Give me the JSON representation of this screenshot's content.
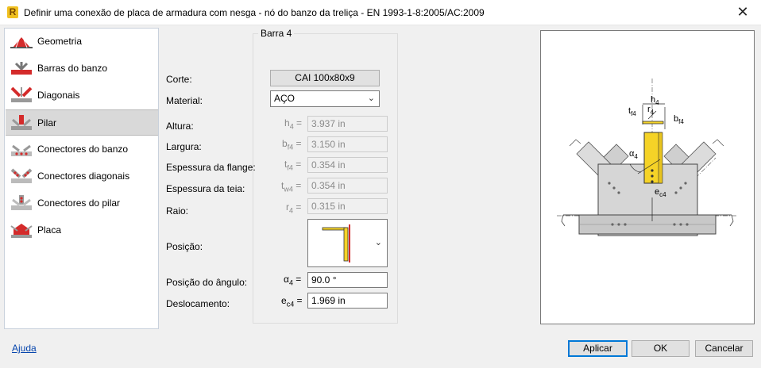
{
  "window": {
    "title": "Definir uma conexão de placa de armadura com nesga - nó do banzo da treliça - EN 1993-1-8:2005/AC:2009",
    "close": "✕"
  },
  "nav": {
    "items": [
      {
        "label": "Geometria",
        "icon": "truss-geometry-icon"
      },
      {
        "label": "Barras do banzo",
        "icon": "chord-bars-icon"
      },
      {
        "label": "Diagonais",
        "icon": "diagonals-icon"
      },
      {
        "label": "Pilar",
        "icon": "column-icon",
        "selected": true
      },
      {
        "label": "Conectores do banzo",
        "icon": "chord-connectors-icon"
      },
      {
        "label": "Conectores diagonais",
        "icon": "diagonal-connectors-icon"
      },
      {
        "label": "Conectores do pilar",
        "icon": "column-connectors-icon"
      },
      {
        "label": "Placa",
        "icon": "plate-icon"
      }
    ]
  },
  "form": {
    "group_title": "Barra 4",
    "corte": {
      "label": "Corte:",
      "value": "CAI 100x80x9"
    },
    "material": {
      "label": "Material:",
      "value": "AÇO"
    },
    "altura": {
      "label": "Altura:",
      "sym": "h",
      "sub": "4",
      "eq": "=",
      "value": "3.937 in"
    },
    "largura": {
      "label": "Largura:",
      "sym": "b",
      "sub": "f4",
      "eq": "=",
      "value": "3.150 in"
    },
    "esp_flange": {
      "label": "Espessura da flange:",
      "sym": "t",
      "sub": "f4",
      "eq": "=",
      "value": "0.354 in"
    },
    "esp_teia": {
      "label": "Espessura da teia:",
      "sym": "t",
      "sub": "w4",
      "eq": "=",
      "value": "0.354 in"
    },
    "raio": {
      "label": "Raio:",
      "sym": "r",
      "sub": "4",
      "eq": "=",
      "value": "0.315 in"
    },
    "posicao": {
      "label": "Posição:"
    },
    "pos_angulo": {
      "label": "Posição do ângulo:",
      "sym": "α",
      "sub": "4",
      "eq": "=",
      "value": "90.0 °"
    },
    "deslocamento": {
      "label": "Deslocamento:",
      "sym": "e",
      "sub": "c4",
      "eq": "=",
      "value": "1.969 in"
    }
  },
  "preview": {
    "labels": {
      "h": "h",
      "h_sub": "4",
      "r": "r",
      "r_sub": "4",
      "t": "t",
      "t_sub": "f4",
      "b": "b",
      "b_sub": "f4",
      "alpha": "α",
      "alpha_sub": "4",
      "e": "e",
      "e_sub": "c4"
    }
  },
  "footer": {
    "help": "Ajuda",
    "apply": "Aplicar",
    "ok": "OK",
    "cancel": "Cancelar"
  },
  "colors": {
    "accent_red": "#d42b2b",
    "highlight_yellow": "#f5d327",
    "steel_gray": "#c8c8c8"
  }
}
